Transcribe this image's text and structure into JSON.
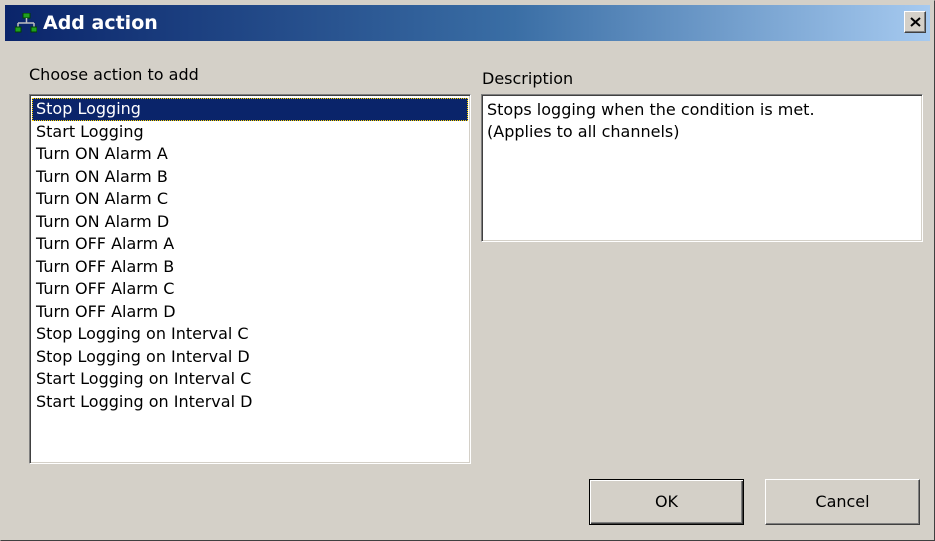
{
  "window": {
    "title": "Add action",
    "title_icon": "network-tree-icon",
    "close_icon": "close-x-icon"
  },
  "actions": {
    "label": "Choose action to add",
    "selected_index": 0,
    "items": [
      "Stop Logging",
      "Start Logging",
      "Turn ON Alarm A",
      "Turn ON Alarm B",
      "Turn ON Alarm C",
      "Turn ON Alarm D",
      "Turn OFF Alarm A",
      "Turn OFF Alarm B",
      "Turn OFF Alarm C",
      "Turn OFF Alarm D",
      "Stop Logging on Interval C",
      "Stop Logging on Interval D",
      "Start Logging on Interval C",
      "Start Logging on Interval D"
    ]
  },
  "description": {
    "label": "Description",
    "text": "Stops logging when the condition is met.\n(Applies to all channels)"
  },
  "buttons": {
    "ok": "OK",
    "cancel": "Cancel"
  },
  "colors": {
    "title_gradient_start": "#0a246a",
    "title_gradient_end": "#a6caf0",
    "selection": "#0a246a",
    "dialog_face": "#d4d0c8"
  }
}
